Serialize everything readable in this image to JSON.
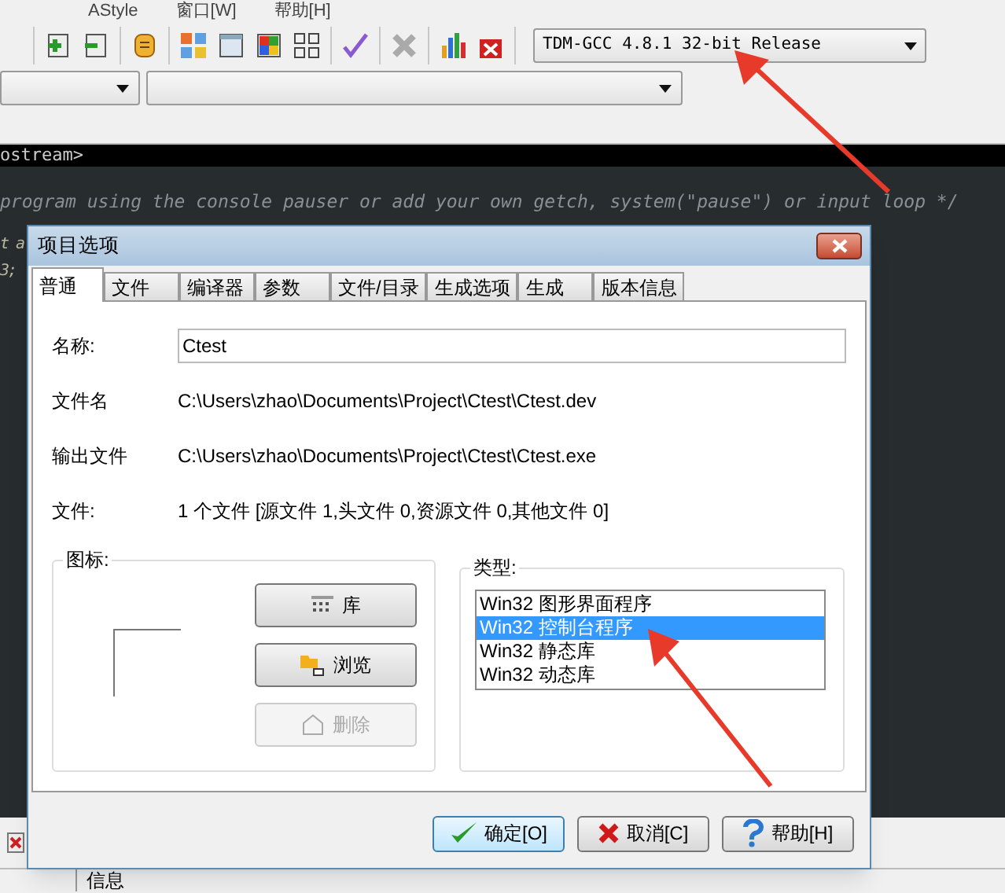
{
  "menu": [
    "AStyle",
    "窗口[W]",
    "帮助[H]"
  ],
  "toolbar": {
    "compiler": "TDM-GCC 4.8.1 32-bit Release"
  },
  "editor": {
    "tab": "ostream>",
    "lines": [
      {
        "kind": "comment",
        "text": "program using the console pauser or add your own getch, system(\"pause\") or input loop */"
      },
      {
        "kind": "code",
        "text": "t a"
      },
      {
        "kind": "code",
        "text": "3;"
      }
    ]
  },
  "bottom_panel": {
    "tab": "信息"
  },
  "dialog": {
    "title": "项目选项",
    "tabs": [
      {
        "label": "普通",
        "selected": true
      },
      {
        "label": "文件",
        "selected": false
      },
      {
        "label": "编译器",
        "selected": false
      },
      {
        "label": "参数",
        "selected": false
      },
      {
        "label": "文件/目录",
        "selected": false
      },
      {
        "label": "生成选项",
        "selected": false
      },
      {
        "label": "生成",
        "selected": false
      },
      {
        "label": "版本信息",
        "selected": false
      }
    ],
    "fields": [
      {
        "kind": "input",
        "label": "名称:",
        "value": "Ctest"
      },
      {
        "kind": "text",
        "label": "文件名",
        "value": "C:\\Users\\zhao\\Documents\\Project\\Ctest\\Ctest.dev"
      },
      {
        "kind": "text",
        "label": "输出文件",
        "value": "C:\\Users\\zhao\\Documents\\Project\\Ctest\\Ctest.exe"
      },
      {
        "kind": "text",
        "label": "文件:",
        "value": "1 个文件 [源文件 1,头文件 0,资源文件 0,其他文件 0]"
      }
    ],
    "icon_group": {
      "title": "图标:",
      "buttons": [
        {
          "label": "库",
          "kind": "library",
          "disabled": false
        },
        {
          "label": "浏览",
          "kind": "browse",
          "disabled": false
        },
        {
          "label": "删除",
          "kind": "delete",
          "disabled": true
        }
      ]
    },
    "type_group": {
      "title": "类型:",
      "items": [
        {
          "label": "Win32 图形界面程序",
          "selected": false
        },
        {
          "label": "Win32 控制台程序",
          "selected": true
        },
        {
          "label": "Win32 静态库",
          "selected": false
        },
        {
          "label": "Win32 动态库",
          "selected": false
        }
      ]
    },
    "buttons": [
      {
        "label": "确定[O]",
        "kind": "ok"
      },
      {
        "label": "取消[C]",
        "kind": "cancel"
      },
      {
        "label": "帮助[H]",
        "kind": "help"
      }
    ]
  }
}
